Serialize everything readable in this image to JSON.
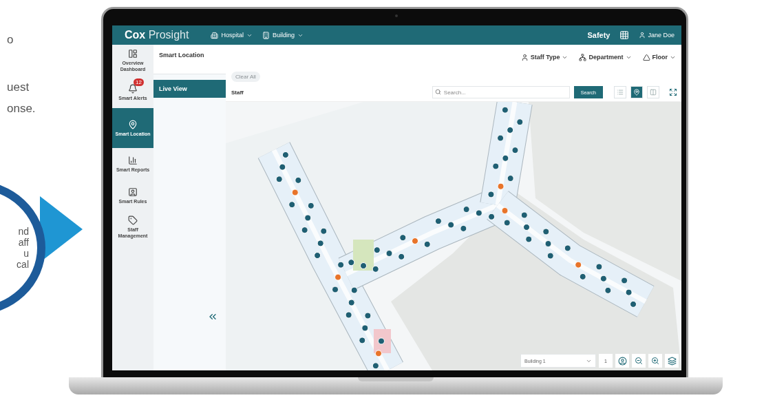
{
  "slide": {
    "lines": [
      "o",
      "uest",
      "onse."
    ],
    "callout_lines": [
      "nd",
      "aff",
      "u",
      "cal"
    ]
  },
  "header": {
    "brand": "Cox",
    "product": "Prosight",
    "menus": [
      {
        "label": "Hospital"
      },
      {
        "label": "Building"
      }
    ],
    "module": "Safety",
    "user": "Jane Doe"
  },
  "nav": [
    {
      "label": "Overview Dashboard",
      "selected": false
    },
    {
      "label": "Smart Alerts",
      "selected": false,
      "badge": "12"
    },
    {
      "label": "Smart Location",
      "selected": true
    },
    {
      "label": "Smart Reports",
      "selected": false
    },
    {
      "label": "Smart Rules",
      "selected": false
    },
    {
      "label": "Staff Management",
      "selected": false
    }
  ],
  "panel": {
    "title": "Smart Location",
    "items": [
      {
        "label": "Live View",
        "selected": true
      }
    ]
  },
  "filters": [
    {
      "label": "Staff Type"
    },
    {
      "label": "Department"
    },
    {
      "label": "Floor"
    }
  ],
  "clear_all": "Clear All",
  "search": {
    "title": "Staff",
    "placeholder": "Search...",
    "button": "Search"
  },
  "view_modes": [
    {
      "selected": false
    },
    {
      "selected": true
    },
    {
      "selected": false
    }
  ],
  "map_controls": {
    "building": "Building 1",
    "floor": "1"
  }
}
